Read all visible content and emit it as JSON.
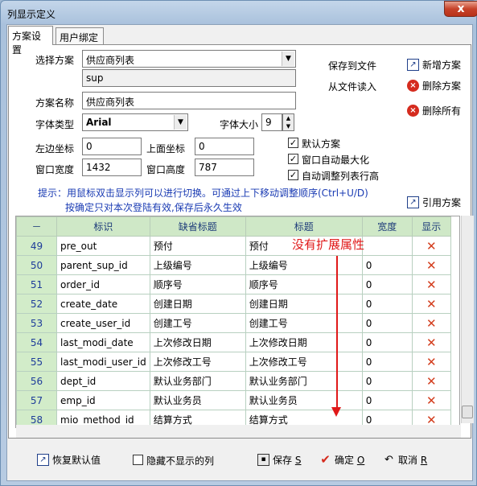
{
  "window": {
    "title": "列显示定义",
    "close": "x"
  },
  "tabs": [
    {
      "label": "方案设置"
    },
    {
      "label": "用户绑定"
    }
  ],
  "form": {
    "scheme_label": "选择方案",
    "scheme_value": "供应商列表",
    "scheme_code": "sup",
    "name_label": "方案名称",
    "name_value": "供应商列表",
    "font_label": "字体类型",
    "font_value": "Arial",
    "size_label": "字体大小",
    "size_value": "9",
    "left_label": "左边坐标",
    "left_value": "0",
    "top_label": "上面坐标",
    "top_value": "0",
    "width_label": "窗口宽度",
    "width_value": "1432",
    "height_label": "窗口高度",
    "height_value": "787",
    "default_scheme": "默认方案",
    "auto_max": "窗口自动最大化",
    "auto_row_height": "自动调整列表行高"
  },
  "actions": {
    "save_to_file": "保存到文件",
    "read_from_file": "从文件读入",
    "new_scheme": "新增方案",
    "delete_scheme": "删除方案",
    "delete_all": "删除所有",
    "cite_scheme": "引用方案"
  },
  "hints": {
    "line1": "提示：用鼠标双击显示列可以进行切换。可通过上下移动调整顺序(Ctrl+U/D)",
    "line2": "按确定只对本次登陆有效,保存后永久生效"
  },
  "table": {
    "corner": "－",
    "headers": [
      "标识",
      "缺省标题",
      "标题",
      "宽度",
      "显示"
    ],
    "rows": [
      {
        "n": "49",
        "id": "pre_out",
        "def": "预付",
        "title": "预付",
        "w": "",
        "show": "✕"
      },
      {
        "n": "50",
        "id": "parent_sup_id",
        "def": "上级编号",
        "title": "上级编号",
        "w": "0",
        "show": "✕"
      },
      {
        "n": "51",
        "id": "order_id",
        "def": "顺序号",
        "title": "顺序号",
        "w": "0",
        "show": "✕"
      },
      {
        "n": "52",
        "id": "create_date",
        "def": "创建日期",
        "title": "创建日期",
        "w": "0",
        "show": "✕"
      },
      {
        "n": "53",
        "id": "create_user_id",
        "def": "创建工号",
        "title": "创建工号",
        "w": "0",
        "show": "✕"
      },
      {
        "n": "54",
        "id": "last_modi_date",
        "def": "上次修改日期",
        "title": "上次修改日期",
        "w": "0",
        "show": "✕"
      },
      {
        "n": "55",
        "id": "last_modi_user_id",
        "def": "上次修改工号",
        "title": "上次修改工号",
        "w": "0",
        "show": "✕"
      },
      {
        "n": "56",
        "id": "dept_id",
        "def": "默认业务部门",
        "title": "默认业务部门",
        "w": "0",
        "show": "✕"
      },
      {
        "n": "57",
        "id": "emp_id",
        "def": "默认业务员",
        "title": "默认业务员",
        "w": "0",
        "show": "✕"
      },
      {
        "n": "58",
        "id": "mio_method_id",
        "def": "结算方式",
        "title": "结算方式",
        "w": "0",
        "show": "✕"
      }
    ]
  },
  "annotation": "没有扩展属性",
  "bottom": {
    "restore": "恢复默认值",
    "hide_hidden": "隐藏不显示的列",
    "save": "保存",
    "save_key": "S",
    "ok": "确定",
    "ok_key": "O",
    "cancel": "取消",
    "cancel_key": "R"
  }
}
